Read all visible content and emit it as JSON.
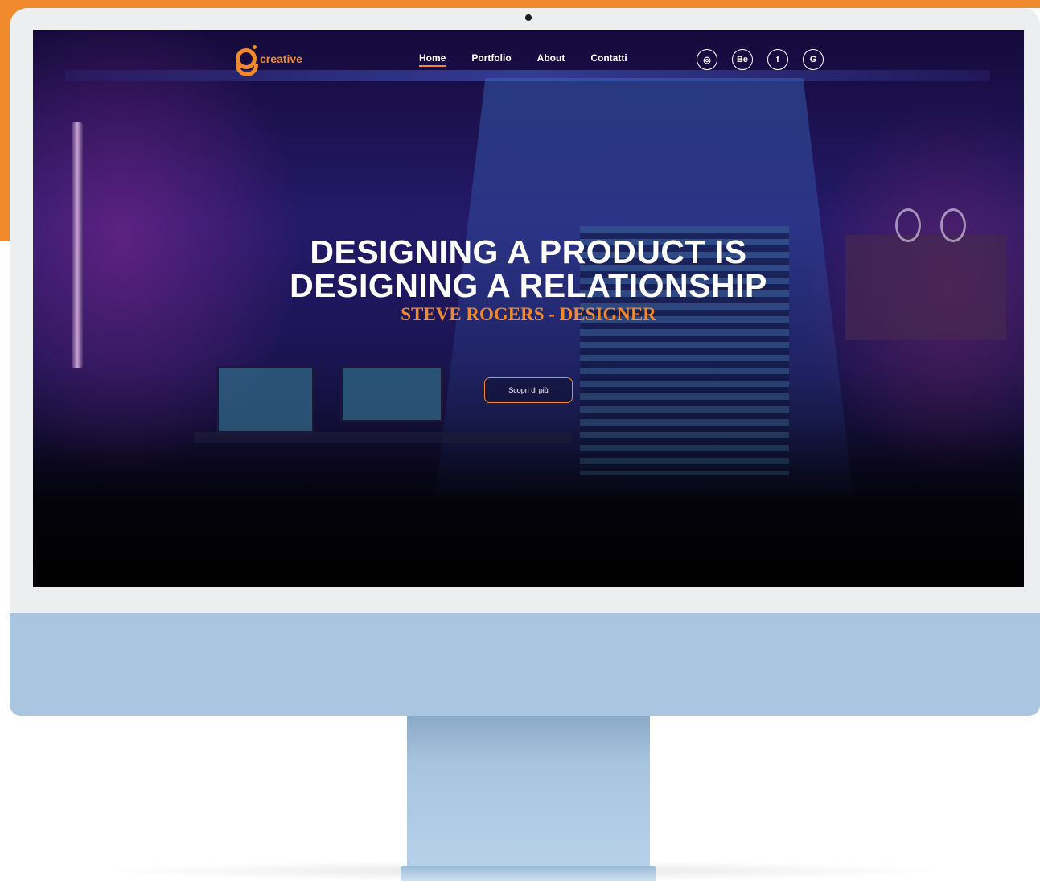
{
  "brand": {
    "name": "creative",
    "color": "#f08a2c"
  },
  "nav": {
    "items": [
      {
        "label": "Home",
        "active": true
      },
      {
        "label": "Portfolio",
        "active": false
      },
      {
        "label": "About",
        "active": false
      },
      {
        "label": "Contatti",
        "active": false
      }
    ]
  },
  "socials": [
    {
      "icon": "instagram-icon",
      "glyph": "◎"
    },
    {
      "icon": "behance-icon",
      "glyph": "Be"
    },
    {
      "icon": "facebook-icon",
      "glyph": "f"
    },
    {
      "icon": "google-icon",
      "glyph": "G"
    }
  ],
  "hero": {
    "line1": "DESIGNING A PRODUCT IS",
    "line2": "DESIGNING A RELATIONSHIP",
    "author": "STEVE ROGERS - DESIGNER",
    "cta": "Scopri di più"
  }
}
